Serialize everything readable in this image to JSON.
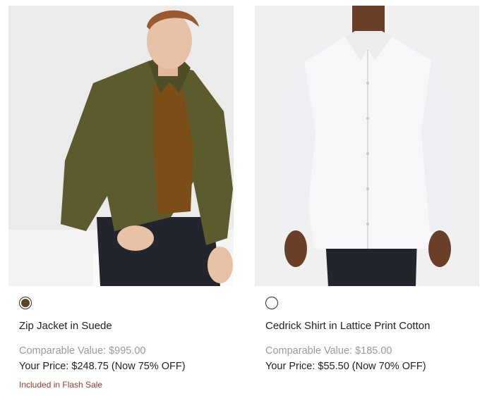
{
  "products": [
    {
      "name": "Zip Jacket in Suede",
      "swatch_color": "#5a4526",
      "comparable_value": "Comparable Value: $995.00",
      "your_price": "Your Price: $248.75 (Now 75% OFF)",
      "badge": "Included in Flash Sale"
    },
    {
      "name": "Cedrick Shirt in Lattice Print Cotton",
      "swatch_color": "#ffffff",
      "comparable_value": "Comparable Value: $185.00",
      "your_price": "Your Price: $55.50 (Now 70% OFF)"
    }
  ]
}
